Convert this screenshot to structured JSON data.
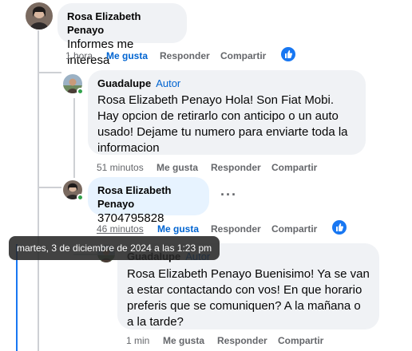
{
  "comments": [
    {
      "author": "Rosa Elizabeth Penayo",
      "text": "Informes me interesa",
      "time": "1 hora",
      "like_label": "Me gusta",
      "reply_label": "Responder",
      "share_label": "Compartir",
      "liked": true
    },
    {
      "author": "Guadalupe",
      "author_badge": "Autor",
      "text": "Rosa Elizabeth Penayo Hola! Son Fiat Mobi. Hay opcion de retirarlo con anticipo o un auto usado! Dejame tu numero para enviarte toda la informacion",
      "time": "51 minutos",
      "like_label": "Me gusta",
      "reply_label": "Responder",
      "share_label": "Compartir",
      "liked": false
    },
    {
      "author": "Rosa Elizabeth Penayo",
      "text": "3704795828",
      "time": "46 minutos",
      "like_label": "Me gusta",
      "reply_label": "Responder",
      "share_label": "Compartir",
      "liked": true,
      "more_icon": "ellipsis-icon"
    },
    {
      "author": "Guadalupe",
      "author_badge": "Autor",
      "text": "Rosa Elizabeth Penayo Buenisimo! Ya se van a estar contactando con vos! En que horario preferis que se comuniquen? A la mañana o a la tarde?",
      "time": "1 min",
      "like_label": "Me gusta",
      "reply_label": "Responder",
      "share_label": "Compartir",
      "liked": false
    }
  ],
  "tooltip": "martes, 3 de diciembre de 2024 a las 1:23 pm",
  "colors": {
    "bubble": "#f0f2f5",
    "bubble_highlight": "#e7f3ff",
    "accent": "#0064d1",
    "muted": "#65676b",
    "online": "#31a24c"
  }
}
